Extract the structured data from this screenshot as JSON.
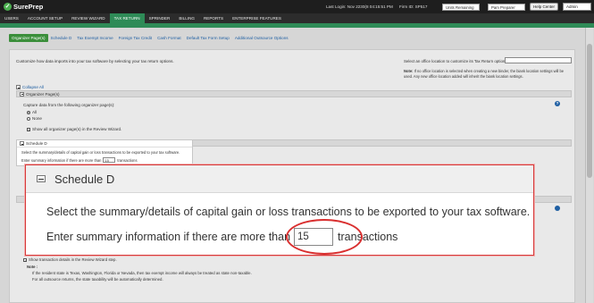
{
  "header": {
    "logo_text": "SurePrep",
    "logo_mark": "✓",
    "last_login": "Last Login: Nov 2230(8 04:15:51 PM",
    "firm_id": "Firm ID: SP517",
    "units_select": "Units Remaining",
    "user_select": "Pam Preparer",
    "help_button": "Help Center",
    "admin_select": "Admin"
  },
  "mainnav": {
    "items": [
      "USERS",
      "ACCOUNT SETUP",
      "REVIEW WIZARD",
      "TAX RETURN",
      "SPRINDER",
      "BILLING",
      "REPORTS",
      "ENTERPRISE FEATURES"
    ],
    "active_index": 3
  },
  "subtabs": {
    "items": [
      "Organizer Page(s)",
      "Schedule D",
      "Tax Exempt Income",
      "Foreign Tax Credit",
      "Cash Format",
      "Default Tax Form Setup",
      "Additional Outsource Options"
    ],
    "active_index": 0
  },
  "page": {
    "intro": "Customize how data imports into your tax software by selecting your tax return options.",
    "office_label": "Select an office location to customize its Tax Return options:",
    "office_note_bold": "Note:",
    "office_note": " If no office location is selected when creating a new binder, the biank location settings will be used. Any new office location added will inherit the biank location settings.",
    "collapse_all": "Collapse All"
  },
  "organizer": {
    "header": "Organizer Page(s)",
    "capture_label": "Capture data from the following organizer page(s):",
    "opt_all": "All",
    "opt_none": "None",
    "show_all": "Show all organizer page(s) in the Review Wizard.",
    "help": "?"
  },
  "small_schedule": {
    "title": "Schedule D",
    "line1": "Select the summary/details of capital gain or loss transactions to be exported to your tax software.",
    "line2_prefix": "Enter summary information if there are more than",
    "value": "15",
    "line2_suffix": "transactions"
  },
  "lower": {
    "state_label": "State taxable",
    "show_details": "Show transaction details in the Review Wizard step.",
    "note_label": "Note :",
    "note1": "If the resident state is Texas, Washington, Florida or Nevada, then tax exempt income will always be treated as state non-taxable.",
    "note2": "For all outsource returns, the state taxability will be automatically determined."
  },
  "callout": {
    "title": "Schedule D",
    "line1": "Select the summary/details of capital gain or loss transactions to be exported to your tax software.",
    "line2_prefix": "Enter summary information if there are more than",
    "value": "15",
    "line2_suffix": "transactions"
  },
  "colors": {
    "header_bg": "#1e1e1e",
    "nav_bg": "#2c2c2c",
    "accent_green": "#2e8b57",
    "link_blue": "#1f5fa3",
    "highlight_red": "#d92f2f"
  }
}
